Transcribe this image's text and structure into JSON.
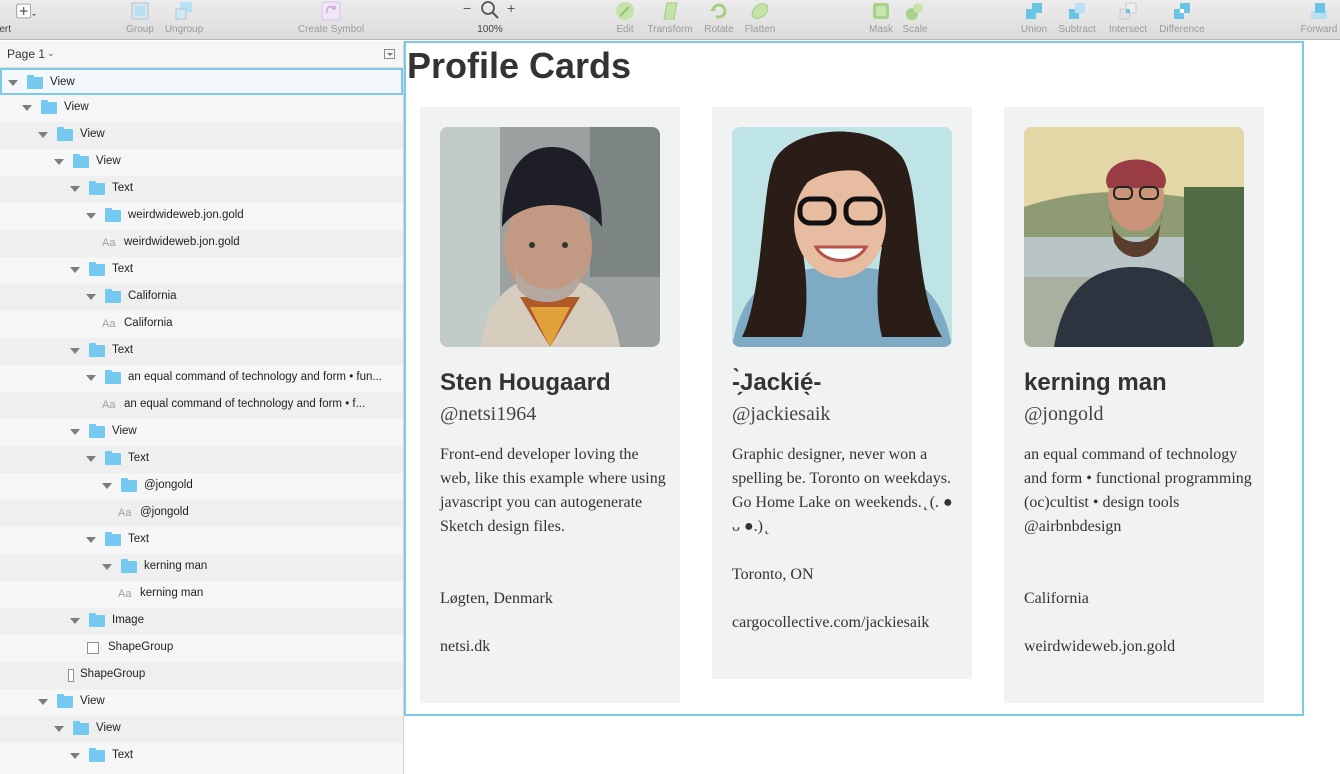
{
  "toolbar": {
    "items": [
      {
        "label": "Insert"
      },
      {
        "label": "Group"
      },
      {
        "label": "Ungroup"
      },
      {
        "label": "Create Symbol"
      },
      {
        "label": "100%"
      },
      {
        "label": "Edit"
      },
      {
        "label": "Transform"
      },
      {
        "label": "Rotate"
      },
      {
        "label": "Flatten"
      },
      {
        "label": "Mask"
      },
      {
        "label": "Scale"
      },
      {
        "label": "Union"
      },
      {
        "label": "Subtract"
      },
      {
        "label": "Intersect"
      },
      {
        "label": "Difference"
      },
      {
        "label": "Forward"
      }
    ],
    "zoom_minus": "−",
    "zoom_plus": "+"
  },
  "sidebar": {
    "page_name": "Page 1",
    "layers": [
      {
        "label": "View",
        "type": "group"
      },
      {
        "label": "View",
        "type": "group"
      },
      {
        "label": "View",
        "type": "group"
      },
      {
        "label": "View",
        "type": "group"
      },
      {
        "label": "Text",
        "type": "group"
      },
      {
        "label": "weirdwideweb.jon.gold",
        "type": "group"
      },
      {
        "label": "weirdwideweb.jon.gold",
        "type": "text"
      },
      {
        "label": "Text",
        "type": "group"
      },
      {
        "label": "California",
        "type": "group"
      },
      {
        "label": "California",
        "type": "text"
      },
      {
        "label": "Text",
        "type": "group"
      },
      {
        "label": "an equal command of technology and form • fun...",
        "type": "group"
      },
      {
        "label": "an equal command of technology and form • f...",
        "type": "text"
      },
      {
        "label": "View",
        "type": "group"
      },
      {
        "label": "Text",
        "type": "group"
      },
      {
        "label": "@jongold",
        "type": "group"
      },
      {
        "label": "@jongold",
        "type": "text"
      },
      {
        "label": "Text",
        "type": "group"
      },
      {
        "label": "kerning man",
        "type": "group"
      },
      {
        "label": "kerning man",
        "type": "text"
      },
      {
        "label": "Image",
        "type": "group"
      },
      {
        "label": "ShapeGroup",
        "type": "shape"
      },
      {
        "label": "ShapeGroup",
        "type": "shape"
      },
      {
        "label": "View",
        "type": "group"
      },
      {
        "label": "View",
        "type": "group"
      },
      {
        "label": "Text",
        "type": "group"
      }
    ]
  },
  "canvas": {
    "title": "Profile Cards",
    "cards": [
      {
        "name": "Sten Hougaard",
        "handle": "@netsi1964",
        "bio": "Front-end developer loving the web, like this example where using javascript you can autogenerate Sketch design files.",
        "location": "Løgten, Denmark",
        "url": "netsi.dk"
      },
      {
        "name": "-̗̀Jackié̖-",
        "handle": "@jackiesaik",
        "bio": "Graphic designer, never won a spelling be. Toronto on weekdays. Go Home Lake on weekends. ̨ (. ● ᴗ ●.) ̨",
        "location": "Toronto, ON",
        "url": "cargocollective.com/jackiesaik"
      },
      {
        "name": "kerning man",
        "handle": "@jongold",
        "bio": "an equal command of technology and form • functional programming (oc)cultist • design tools @airbnbdesign",
        "location": "California",
        "url": "weirdwideweb.jon.gold"
      }
    ]
  }
}
